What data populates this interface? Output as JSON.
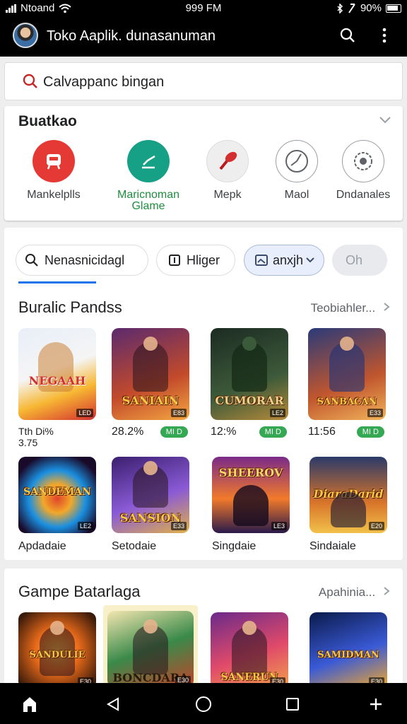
{
  "status": {
    "carrier": "Ntoand",
    "time": "999 FM",
    "battery": "90%"
  },
  "app_bar": {
    "title": "Toko Aaplik. dunasanuman"
  },
  "search": {
    "query": "Calvappanc bingan"
  },
  "categories": {
    "title": "Buatkao",
    "items": [
      {
        "label": "Mankelplls",
        "color": "#e53935",
        "icon": "bus-icon"
      },
      {
        "label": "Maricnoman\nGlame",
        "color": "#16a085",
        "label_color": "#1e8e3e",
        "icon": "chart-icon"
      },
      {
        "label": "Mepk",
        "color": "#eeeeee",
        "icon": "paint-icon"
      },
      {
        "label": "Maol",
        "color": "#ffffff",
        "icon": "clock-icon"
      },
      {
        "label": "Dndanales",
        "color": "#ffffff",
        "icon": "settings-icon"
      }
    ]
  },
  "filters": {
    "chip_1": "Nenasnicidagl",
    "chip_2": "Hliger",
    "chip_3": "anxjh",
    "chip_4": "Oh"
  },
  "section_1": {
    "title": "Buralic Pandss",
    "link": "Teobiahler...",
    "games": [
      {
        "title": "NEGAAH",
        "badge": "LED",
        "price": "Tth Di%\n3.75",
        "pill": "",
        "colors": [
          "#f5f5f5",
          "#f7b733",
          "#d32f2f"
        ]
      },
      {
        "title": "SANIAIN",
        "badge": "E83",
        "price": "28.2%",
        "pill": "MI D",
        "colors": [
          "#5b2a6e",
          "#c24a2b",
          "#f4a742"
        ]
      },
      {
        "title": "CUMORAR",
        "badge": "LE2",
        "price": "12:%",
        "pill": "MI D",
        "colors": [
          "#1c2b22",
          "#3d5a3a",
          "#b68a3a"
        ]
      },
      {
        "title": "SANBACAN",
        "badge": "E33",
        "price": "11:56",
        "pill": "MI D",
        "colors": [
          "#2a3a7a",
          "#c0562e",
          "#f2b45a"
        ]
      }
    ],
    "games_row2": [
      {
        "title": "SANDEMAN",
        "badge": "LE2",
        "name": "Apdadaie",
        "colors": [
          "#1a0a2a",
          "#e0452a",
          "#1a8fe0"
        ]
      },
      {
        "title": "SANSION",
        "badge": "E33",
        "name": "Setodaie",
        "colors": [
          "#3a1f6e",
          "#8a5ad6",
          "#e0b04a"
        ]
      },
      {
        "title": "SHEEROV",
        "badge": "LE3",
        "name": "Singdaie",
        "colors": [
          "#f27a2a",
          "#7a2a8a",
          "#2a1a4a"
        ]
      },
      {
        "title": "DiaraDarid",
        "badge": "E20",
        "name": "Sindaiale",
        "colors": [
          "#2a3a6a",
          "#d8742a",
          "#f2c14a"
        ]
      }
    ]
  },
  "section_2": {
    "title": "Gampe Batarlaga",
    "link": "Apahinia...",
    "games": [
      {
        "title": "SANDULIE",
        "badge": "E30",
        "colors": [
          "#3a1a0a",
          "#e86a1a",
          "#f2b43a"
        ]
      },
      {
        "title": "BONCDARA",
        "badge": "E30",
        "colors": [
          "#f4e6b0",
          "#3a8a4a",
          "#c2432a"
        ]
      },
      {
        "title": "SANERUN",
        "badge": "E30",
        "colors": [
          "#6a2a8a",
          "#e04a6a",
          "#f2a24a"
        ]
      },
      {
        "title": "SAMIDMAN",
        "badge": "E30",
        "colors": [
          "#0a1a4a",
          "#3a5ad6",
          "#f2a82a"
        ]
      }
    ]
  }
}
